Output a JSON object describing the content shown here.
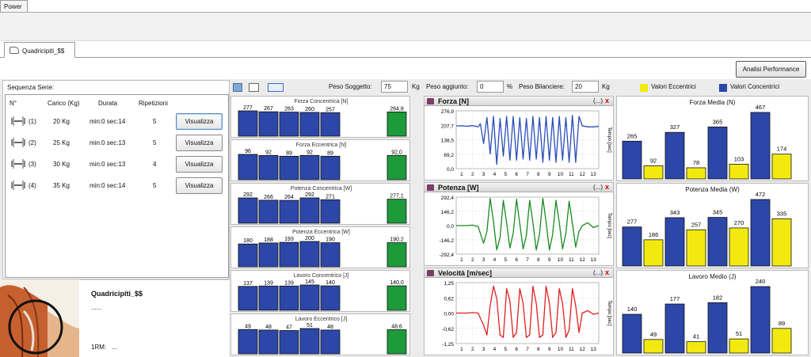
{
  "app": {
    "top_tab": "Power"
  },
  "doc_tab": {
    "label": "Quadricipiti_$$"
  },
  "toolbar": {
    "analisi_label": "Analisi Performance"
  },
  "series": {
    "title": "Sequenza Serie:",
    "headers": [
      "N°",
      "Carico (Kg)",
      "Durata",
      "Ripetizioni"
    ],
    "rows": [
      {
        "n": "(1)",
        "carico": "20 Kg",
        "durata": "min:0 sec:14",
        "rip": "5",
        "btn": "Visualizza"
      },
      {
        "n": "(2)",
        "carico": "25 Kg",
        "durata": "min:0 sec:13",
        "rip": "5",
        "btn": "Visualizza"
      },
      {
        "n": "(3)",
        "carico": "30 Kg",
        "durata": "min:0 sec:13",
        "rip": "4",
        "btn": "Visualizza"
      },
      {
        "n": "(4)",
        "carico": "35 Kg",
        "durata": "min:0 sec:14",
        "rip": "5",
        "btn": "Visualizza"
      }
    ]
  },
  "exercise": {
    "name": "Quadricipiti_$$",
    "dots": "......",
    "rm_label": "1RM:",
    "rm_value": "..."
  },
  "params": {
    "peso_soggetto_label": "Peso Soggetto:",
    "peso_soggetto": "75",
    "peso_soggetto_unit": "Kg",
    "peso_aggiunto_label": "Peso aggiunto:",
    "peso_aggiunto": "0",
    "peso_aggiunto_unit": "%",
    "peso_bilanciere_label": "Peso Bilanciere:",
    "peso_bilanciere": "20",
    "peso_bilanciere_unit": "Kg"
  },
  "legend": {
    "ecc": "Valori Eccentrici",
    "conc": "Valori Concentrici",
    "ecc_color": "#f2ea0f",
    "conc_color": "#2c47a8"
  },
  "colors": {
    "blue": "#2c47a8",
    "green": "#1d9a3a",
    "yellow": "#f2ea0f",
    "force_line": "#2a4db8",
    "power_line": "#1a8a22",
    "velocity_line": "#e02020"
  },
  "graph_panels": [
    {
      "title": "Forza [N]",
      "dots": "(...)",
      "close": "x",
      "yticks": [
        "276,9",
        "207,7",
        "138,5",
        "69,2",
        "0,0"
      ],
      "ylabel": "Tempo [sec]",
      "xticks": [
        "1",
        "2",
        "3",
        "4",
        "5",
        "6",
        "7",
        "8",
        "9",
        "10",
        "11",
        "12",
        "13"
      ]
    },
    {
      "title": "Potenza [W]",
      "dots": "(...)",
      "close": "x",
      "yticks": [
        "292,4",
        "146,2",
        "0,0",
        "-146,2",
        "-292,4"
      ],
      "ylabel": "Tempo [sec]",
      "xticks": [
        "1",
        "2",
        "3",
        "4",
        "5",
        "6",
        "7",
        "8",
        "9",
        "10",
        "11",
        "12",
        "13"
      ]
    },
    {
      "title": "Velocità [m/sec]",
      "dots": "(...)",
      "close": "x",
      "yticks": [
        "1,25",
        "0,62",
        "0,00",
        "-0,62",
        "-1,25"
      ],
      "ylabel": "Tempo [sec]",
      "xticks": [
        "1",
        "2",
        "3",
        "4",
        "5",
        "6",
        "7",
        "8",
        "9",
        "10",
        "11",
        "12",
        "13"
      ]
    }
  ],
  "chart_data": [
    {
      "type": "bar",
      "title": "Forza Concentrica [N]",
      "values": [
        277,
        267,
        263,
        260,
        257
      ],
      "average": 264.8,
      "average_label": "264,8"
    },
    {
      "type": "bar",
      "title": "Forza Eccentrica [N]",
      "values": [
        96,
        92,
        89,
        92,
        89
      ],
      "average": 92.0,
      "average_label": "92,0"
    },
    {
      "type": "bar",
      "title": "Potenza Concentrica [W]",
      "values": [
        292,
        266,
        264,
        292,
        271
      ],
      "average": 277.1,
      "average_label": "277,1"
    },
    {
      "type": "bar",
      "title": "Potenza Eccentrica [W]",
      "values": [
        180,
        188,
        193,
        200,
        190
      ],
      "average": 190.2,
      "average_label": "190,2"
    },
    {
      "type": "bar",
      "title": "Lavoro Concentrico [J]",
      "values": [
        137,
        139,
        139,
        145,
        140
      ],
      "average": 140.0,
      "average_label": "140,0"
    },
    {
      "type": "bar",
      "title": "Lavoro Eccentrico [J]",
      "values": [
        49,
        48,
        47,
        51,
        48
      ],
      "average": 48.6,
      "average_label": "48,6"
    },
    {
      "type": "line",
      "title": "Forza [N]",
      "ylim": [
        0,
        276.9
      ],
      "x": [
        0.5,
        1,
        1.5,
        2,
        2.5,
        2.7,
        3.0,
        3.3,
        3.6,
        3.9,
        4.2,
        4.5,
        4.8,
        5.1,
        5.4,
        5.7,
        6.0,
        6.3,
        6.6,
        6.9,
        7.2,
        7.5,
        7.8,
        8.1,
        8.4,
        8.7,
        9.0,
        9.3,
        9.6,
        9.9,
        10.2,
        10.5,
        10.8,
        11.1,
        11.4,
        11.7,
        12.0,
        12.5,
        13,
        13.5
      ],
      "y": [
        205,
        205,
        203,
        206,
        200,
        215,
        120,
        245,
        70,
        250,
        20,
        240,
        60,
        250,
        40,
        250,
        40,
        245,
        45,
        240,
        40,
        250,
        45,
        245,
        30,
        250,
        40,
        245,
        30,
        250,
        40,
        245,
        30,
        255,
        30,
        250,
        205,
        200,
        200,
        202
      ]
    },
    {
      "type": "line",
      "title": "Potenza [W]",
      "ylim": [
        -292.4,
        292.4
      ],
      "x": [
        0.5,
        1,
        1.5,
        2,
        2.5,
        3.0,
        3.3,
        3.6,
        3.9,
        4.2,
        4.5,
        4.8,
        5.1,
        5.4,
        5.7,
        6.0,
        6.3,
        6.6,
        6.9,
        7.2,
        7.5,
        7.8,
        8.1,
        8.4,
        8.7,
        9.0,
        9.3,
        9.6,
        9.9,
        10.2,
        10.5,
        10.8,
        11.1,
        11.4,
        11.7,
        12.0,
        12.5,
        13,
        13.5
      ],
      "y": [
        0,
        0,
        0,
        5,
        -10,
        -180,
        -60,
        280,
        40,
        -250,
        -120,
        260,
        30,
        -230,
        -80,
        270,
        20,
        -240,
        -100,
        260,
        30,
        -250,
        -90,
        280,
        40,
        -250,
        -90,
        260,
        30,
        -240,
        -80,
        250,
        20,
        -220,
        -60,
        0,
        30,
        -20,
        0
      ]
    },
    {
      "type": "line",
      "title": "Velocità [m/sec]",
      "ylim": [
        -1.25,
        1.25
      ],
      "x": [
        0.5,
        1,
        1.5,
        2,
        2.5,
        3.0,
        3.3,
        3.6,
        3.9,
        4.2,
        4.5,
        4.8,
        5.1,
        5.4,
        5.7,
        6.0,
        6.3,
        6.6,
        6.9,
        7.2,
        7.5,
        7.8,
        8.1,
        8.4,
        8.7,
        9.0,
        9.3,
        9.6,
        9.9,
        10.2,
        10.5,
        10.8,
        11.1,
        11.4,
        11.7,
        12.0,
        12.5,
        13,
        13.5
      ],
      "y": [
        0,
        0,
        0,
        0.02,
        0,
        -0.5,
        -0.9,
        0.3,
        1.1,
        0.6,
        -0.9,
        -1.0,
        1.0,
        0.5,
        -1.0,
        -0.8,
        1.0,
        0.4,
        -1.0,
        -0.9,
        1.1,
        0.4,
        -1.0,
        -0.9,
        1.1,
        0.4,
        -1.0,
        -0.8,
        1.0,
        0.4,
        -1.0,
        -0.7,
        1.0,
        0.3,
        -0.8,
        0,
        0.1,
        -0.05,
        0
      ]
    },
    {
      "type": "bar",
      "title": "Forza Media (N)",
      "series": [
        {
          "name": "Valori Concentrici",
          "values": [
            265,
            327,
            365,
            467
          ]
        },
        {
          "name": "Valori Eccentrici",
          "values": [
            92,
            78,
            103,
            174
          ]
        }
      ]
    },
    {
      "type": "bar",
      "title": "Potenza Media (W)",
      "series": [
        {
          "name": "Valori Concentrici",
          "values": [
            277,
            343,
            345,
            472
          ]
        },
        {
          "name": "Valori Eccentrici",
          "values": [
            186,
            257,
            270,
            335
          ]
        }
      ]
    },
    {
      "type": "bar",
      "title": "Lavoro Medio (J)",
      "series": [
        {
          "name": "Valori Concentrici",
          "values": [
            140,
            177,
            182,
            240
          ]
        },
        {
          "name": "Valori Eccentrici",
          "values": [
            49,
            41,
            51,
            89
          ]
        }
      ]
    }
  ]
}
